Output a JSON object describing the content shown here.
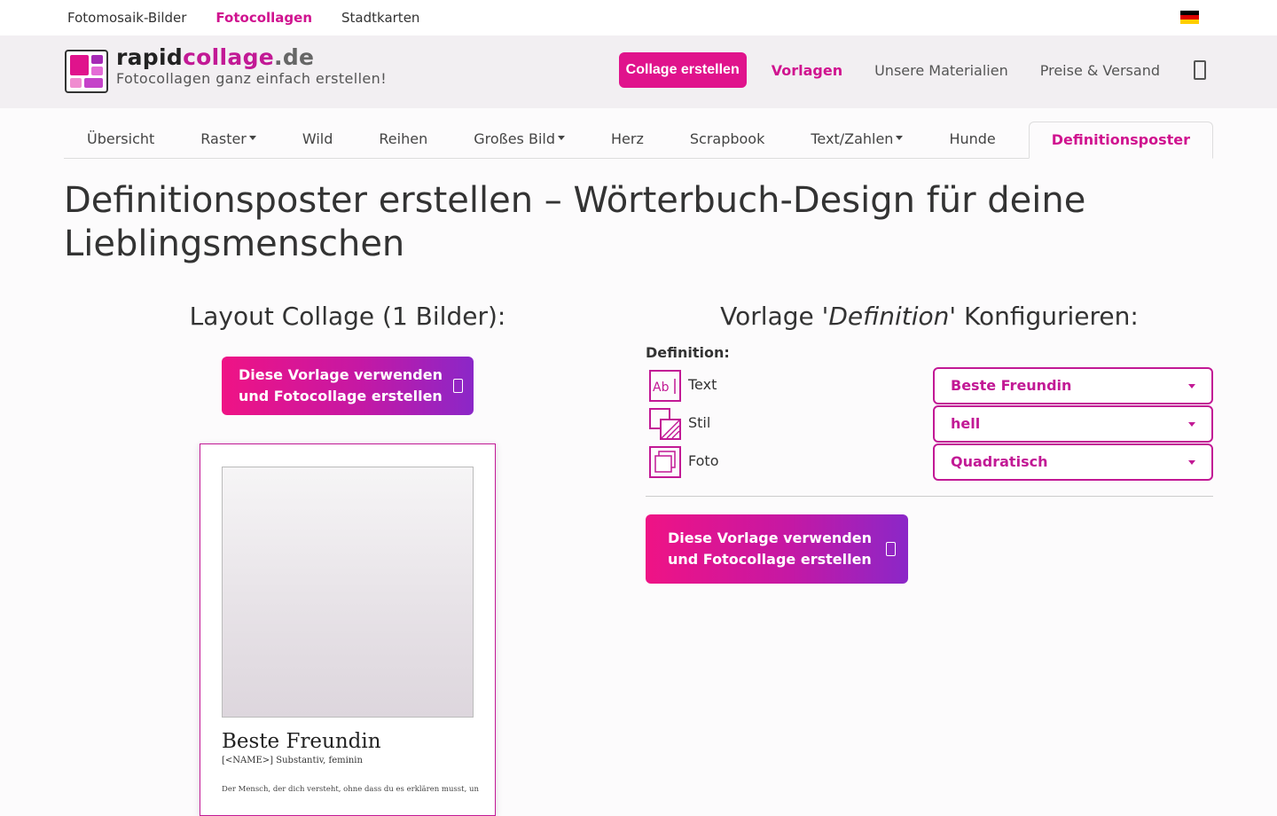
{
  "topbar": {
    "links": [
      {
        "label": "Fotomosaik-Bilder",
        "active": false
      },
      {
        "label": "Fotocollagen",
        "active": true
      },
      {
        "label": "Stadtkarten",
        "active": false
      }
    ],
    "flag_colors": [
      "#000000",
      "#dd0000",
      "#ffce00"
    ]
  },
  "header": {
    "brand_main": "rapid",
    "brand_mid": "collage",
    "brand_tld": ".de",
    "tagline": "Fotocollagen ganz einfach erstellen!",
    "create_button": "Collage erstellen",
    "nav": [
      "Vorlagen",
      "Unsere Materialien",
      "Preise & Versand"
    ],
    "cart_icon": "cart-icon"
  },
  "tabs": [
    {
      "label": "Übersicht",
      "dropdown": false
    },
    {
      "label": "Raster",
      "dropdown": true
    },
    {
      "label": "Wild",
      "dropdown": false
    },
    {
      "label": "Reihen",
      "dropdown": false
    },
    {
      "label": "Großes Bild",
      "dropdown": true
    },
    {
      "label": "Herz",
      "dropdown": false
    },
    {
      "label": "Scrapbook",
      "dropdown": false
    },
    {
      "label": "Text/Zahlen",
      "dropdown": true
    },
    {
      "label": "Hunde",
      "dropdown": false
    },
    {
      "label": "Definitionsposter",
      "dropdown": false,
      "active": true
    }
  ],
  "page": {
    "title": "Definitionsposter erstellen – Wörterbuch-Design für deine Lieblingsmenschen"
  },
  "left": {
    "heading": "Layout Collage (1 Bilder):",
    "cta_line1": "Diese Vorlage verwenden",
    "cta_line2": "und Fotocollage erstellen",
    "poster": {
      "word": "Beste Freundin",
      "sub": "[<NAME>] Substantiv, feminin",
      "definition": "Der Mensch, der dich versteht, ohne dass du es erklären musst, und"
    }
  },
  "right": {
    "heading_pre": "Vorlage '",
    "heading_em": "Definition",
    "heading_post": "' Konfigurieren:",
    "section_label": "Definition:",
    "options": [
      {
        "label": "Text",
        "value": "Beste Freundin",
        "icon": "text-field-icon"
      },
      {
        "label": "Stil",
        "value": "hell",
        "icon": "style-icon"
      },
      {
        "label": "Foto",
        "value": "Quadratisch",
        "icon": "photo-icon"
      }
    ],
    "cta_line1": "Diese Vorlage verwenden",
    "cta_line2": "und Fotocollage erstellen"
  },
  "colors": {
    "accent": "#d0138f",
    "gradient_start": "#ef1385",
    "gradient_end": "#8b27c8"
  }
}
